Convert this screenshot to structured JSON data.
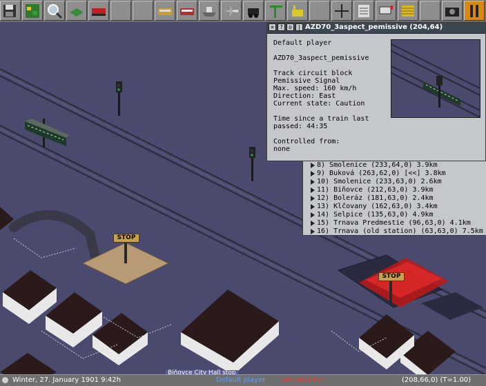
{
  "toolbar": {
    "buttons": [
      {
        "name": "game-menu-button",
        "icon": "floppy-icon"
      },
      {
        "name": "map-button",
        "icon": "map-icon"
      },
      {
        "name": "zoom-button",
        "icon": "magnifier-icon"
      },
      {
        "name": "landscape-button",
        "icon": "terrain-icon"
      },
      {
        "name": "rail-build-button",
        "icon": "train-icon"
      },
      {
        "name": "blank-button-1",
        "icon": ""
      },
      {
        "name": "blank-button-2",
        "icon": ""
      },
      {
        "name": "road-vehicle-button",
        "icon": "bus-icon"
      },
      {
        "name": "tram-button",
        "icon": "tram-icon"
      },
      {
        "name": "ship-button",
        "icon": "ship-icon"
      },
      {
        "name": "airport-button",
        "icon": "plane-icon"
      },
      {
        "name": "locomotive-button",
        "icon": "locomotive-icon"
      },
      {
        "name": "crane-button",
        "icon": "crane-icon"
      },
      {
        "name": "industry-button",
        "icon": "factory-icon"
      },
      {
        "name": "blank-button-3",
        "icon": ""
      },
      {
        "name": "signal-button",
        "icon": "signal-icon"
      },
      {
        "name": "list-button",
        "icon": "list-icon"
      },
      {
        "name": "mailbox-button",
        "icon": "mailbox-icon"
      },
      {
        "name": "finance-button",
        "icon": "coins-icon"
      },
      {
        "name": "blank-button-4",
        "icon": ""
      },
      {
        "name": "screenshot-button",
        "icon": "camera-icon"
      },
      {
        "name": "pause-button",
        "icon": "pause-icon"
      }
    ]
  },
  "info_window": {
    "title": "AZD70_3aspect_pemissive  (204,64)",
    "owner": "Default player",
    "object_name": "AZD70_3aspect_pemissive",
    "type_line1": "Track circuit block",
    "type_line2": "Pemissive Signal",
    "max_speed": "Max. speed: 160 km/h",
    "direction": "Direction: East",
    "state": "Current state: Caution",
    "time_line1": "Time since a train last",
    "time_line2": "passed: 44:35",
    "controlled_label": "Controlled from:",
    "controlled_value": "none"
  },
  "schedule": [
    "8) Smolenice (233,64,0) 3.9km",
    "9) Buková (263,62,0) [<<] 3.8km",
    "10) Smolenice (233,63,0) 2.6km",
    "11) Biňovce (212,63,0) 3.9km",
    "12) Boleráz (181,63,0) 2.4km",
    "13) Klčovany (162,63,0) 3.4km",
    "14) Selpice (135,63,0) 4.9km",
    "15) Trnava Predmestie (96,63,0) 4.1km",
    "16) Trnava (old station) (63,63,0) 7.5km"
  ],
  "map_labels": {
    "stop1": "STOP",
    "stop2": "STOP",
    "city": "Biňovce City Hall stop"
  },
  "status": {
    "date": "Winter, 27. January 1901  9:42h",
    "player": "Default player",
    "money": "-405,863.07¢",
    "coords": "(208,66,0) (T=1.00)"
  },
  "colors": {
    "ground": "#4a4a6e",
    "money_negative": "#ff3030",
    "player": "#5aa0ff",
    "title_bar": "#3b4651",
    "panel": "#c4c8cb"
  }
}
